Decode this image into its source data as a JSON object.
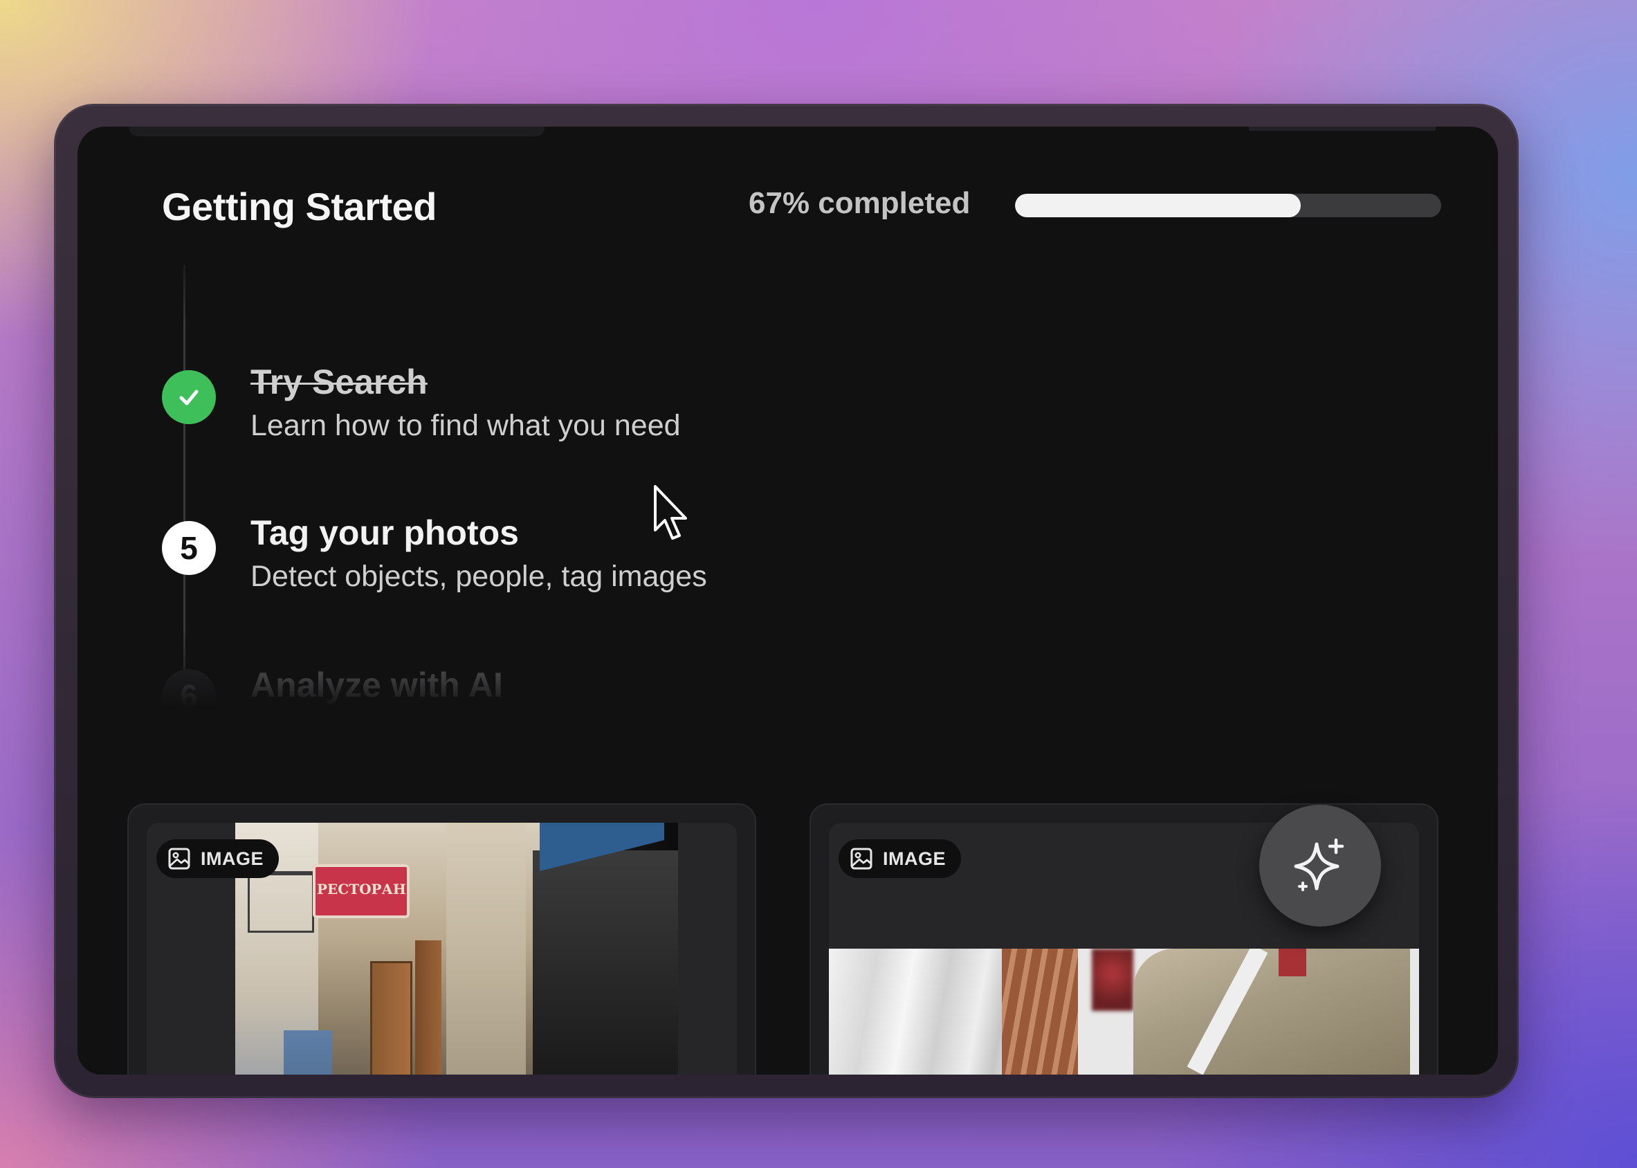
{
  "header": {
    "title": "Getting Started",
    "progress_label": "67% completed",
    "progress_fraction": 0.67
  },
  "steps": [
    {
      "status": "completed",
      "title": "Try Search",
      "description": "Learn how to find what you need"
    },
    {
      "status": "current",
      "number": "5",
      "title": "Tag your photos",
      "description": "Detect objects, people, tag images"
    },
    {
      "status": "upcoming",
      "number": "6",
      "title": "Analyze with AI"
    }
  ],
  "cards": [
    {
      "badge": "IMAGE",
      "sign_text": "РЕСТОРАН"
    },
    {
      "badge": "IMAGE"
    }
  ],
  "icons": {
    "completed_step": "check-icon",
    "badge": "image-icon",
    "ai_button": "sparkle-icon",
    "pointer": "cursor-icon"
  },
  "colors": {
    "completed": "#3fbf5a",
    "background": "#111112",
    "progress_fill": "#f2f2f2"
  }
}
